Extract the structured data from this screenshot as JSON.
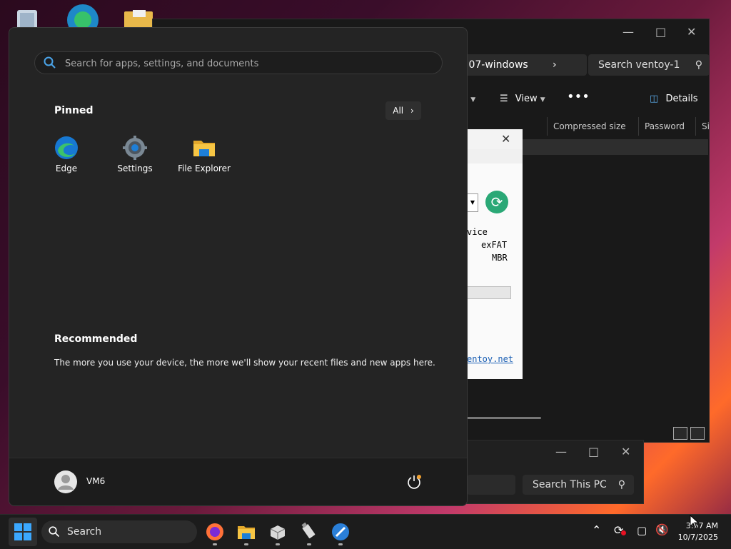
{
  "explorer": {
    "address_tail": ".07-windows",
    "search_label": "Search ventoy-1",
    "toolbar": {
      "sort_tail": "t",
      "view_label": "View",
      "details_label": "Details"
    },
    "columns": [
      "Compressed size",
      "Password ...",
      "Si"
    ]
  },
  "ventoy": {
    "device_tail": "vice",
    "fs": "exFAT",
    "partition": "MBR",
    "link_tail": "entoy.net"
  },
  "thispc": {
    "search_label": "Search This PC"
  },
  "start_menu": {
    "search_placeholder": "Search for apps, settings, and documents",
    "pinned_heading": "Pinned",
    "all_label": "All",
    "pinned_apps": [
      {
        "label": "Edge",
        "icon": "edge-icon"
      },
      {
        "label": "Settings",
        "icon": "gear-icon"
      },
      {
        "label": "File Explorer",
        "icon": "folder-icon"
      }
    ],
    "recommended_heading": "Recommended",
    "recommended_text": "The more you use your device, the more we'll show your recent files and new apps here.",
    "user_name": "VM6"
  },
  "taskbar": {
    "search_label": "Search",
    "time": "3:57 AM",
    "date": "10/7/2025"
  },
  "colors": {
    "accent": "#0078d4",
    "start_bg": "#242424",
    "taskbar_bg": "#1c1c1c"
  }
}
